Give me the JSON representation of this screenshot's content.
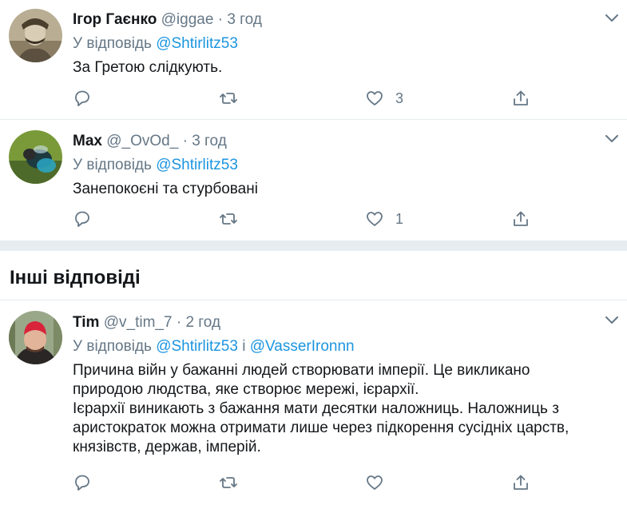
{
  "tweets": [
    {
      "name": "Ігор Гаєнко",
      "handle": "@iggae",
      "separator": "·",
      "time": "3 год",
      "reply_prefix": "У відповідь",
      "mentions": [
        "@Shtirlitz53"
      ],
      "text": "За Гретою слідкують.",
      "likes": "3"
    },
    {
      "name": "Max",
      "handle": "@_OvOd_",
      "separator": "·",
      "time": "3 год",
      "reply_prefix": "У відповідь",
      "mentions": [
        "@Shtirlitz53"
      ],
      "text": "Занепокоєні та стурбовані",
      "likes": "1"
    },
    {
      "name": "Tim",
      "handle": "@v_tim_7",
      "separator": "·",
      "time": "2 год",
      "reply_prefix": "У відповідь",
      "mentions": [
        "@Shtirlitz53",
        "@VasserIronnn"
      ],
      "mention_joiner": "і",
      "text": "Причина війн у бажанні людей створювати імперії. Це викликано природою людства, яке створює мережі, ієрархії.\nІєрархії виникають з бажання мати десятки наложниць. Наложниць з аристократок можна отримати лише через підкорення сусідніх царств, князівств, держав, імперій.",
      "likes": ""
    }
  ],
  "section": {
    "title": "Інші відповіді"
  },
  "colors": {
    "link": "#1b95e0",
    "muted": "#657786",
    "text": "#14171a",
    "divider": "#e6ecf0"
  },
  "icons": [
    "reply-icon",
    "retweet-icon",
    "like-icon",
    "share-icon",
    "chevron-down-icon"
  ]
}
